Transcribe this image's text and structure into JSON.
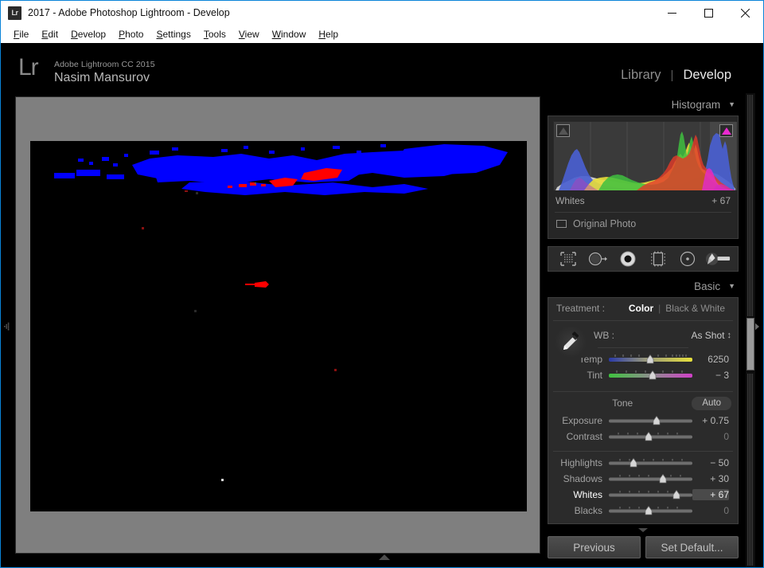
{
  "window": {
    "title": "2017 - Adobe Photoshop Lightroom - Develop",
    "app_icon_label": "Lr",
    "minimize_label": "─",
    "maximize_label": "□",
    "close_label": "✕"
  },
  "menubar": {
    "items": [
      {
        "label": "File",
        "mnemonic": "F"
      },
      {
        "label": "Edit",
        "mnemonic": "E"
      },
      {
        "label": "Develop",
        "mnemonic": "D"
      },
      {
        "label": "Photo",
        "mnemonic": "P"
      },
      {
        "label": "Settings",
        "mnemonic": "S"
      },
      {
        "label": "Tools",
        "mnemonic": "T"
      },
      {
        "label": "View",
        "mnemonic": "V"
      },
      {
        "label": "Window",
        "mnemonic": "W"
      },
      {
        "label": "Help",
        "mnemonic": "H"
      }
    ]
  },
  "identity_plate": {
    "logo": "Lr",
    "line1": "Adobe Lightroom CC 2015",
    "line2": "Nasim Mansurov"
  },
  "module_picker": {
    "modules": [
      {
        "label": "Library",
        "active": false
      },
      {
        "label": "Develop",
        "active": true
      }
    ],
    "separator": "|"
  },
  "panel_toggles": {
    "top": "▲",
    "bottom": "▲",
    "left": "left-panel-toggle",
    "right": "right-panel-toggle"
  },
  "histogram_panel": {
    "title": "Histogram",
    "collapse_glyph": "▼",
    "readout_label": "Whites",
    "readout_value": "+ 67",
    "original_photo_label": "Original Photo",
    "original_photo_checked": false,
    "shadow_clipping_active": false,
    "highlight_clipping_active": true,
    "highlight_clipping_color": "#ea2ad0"
  },
  "tool_strip": {
    "tools": [
      {
        "name": "crop-overlay",
        "title": "Crop Overlay"
      },
      {
        "name": "spot-removal",
        "title": "Spot Removal"
      },
      {
        "name": "red-eye-correction",
        "title": "Red Eye Correction"
      },
      {
        "name": "graduated-filter",
        "title": "Graduated Filter"
      },
      {
        "name": "radial-filter",
        "title": "Radial Filter"
      },
      {
        "name": "adjustment-brush",
        "title": "Adjustment Brush"
      }
    ]
  },
  "basic_panel": {
    "title": "Basic",
    "collapse_glyph": "▼",
    "treatment_label": "Treatment :",
    "treatment_options": [
      {
        "label": "Color",
        "active": true
      },
      {
        "label": "Black & White",
        "active": false
      }
    ],
    "treatment_separator": "|",
    "wb": {
      "label": "WB :",
      "value": "As Shot",
      "stepper_glyph": "↕",
      "sliders": [
        {
          "label": "Temp",
          "value": "6250",
          "pos": 50,
          "gradient": "temp"
        },
        {
          "label": "Tint",
          "value": "− 3",
          "pos": 53,
          "gradient": "tint"
        }
      ]
    },
    "tone": {
      "label": "Tone",
      "auto_label": "Auto",
      "sliders": [
        {
          "label": "Exposure",
          "value": "+ 0.75",
          "pos": 57,
          "active": false,
          "highlighted": false,
          "ticks": false
        },
        {
          "label": "Contrast",
          "value": "0",
          "pos": 48,
          "active": false,
          "highlighted": false,
          "ticks": true,
          "zero": true
        }
      ]
    },
    "presence": {
      "sliders": [
        {
          "label": "Highlights",
          "value": "− 50",
          "pos": 29,
          "active": false,
          "highlighted": false,
          "ticks": true
        },
        {
          "label": "Shadows",
          "value": "+ 30",
          "pos": 65,
          "active": false,
          "highlighted": false,
          "ticks": true
        },
        {
          "label": "Whites",
          "value": "+ 67",
          "pos": 81,
          "active": true,
          "highlighted": true,
          "ticks": true
        },
        {
          "label": "Blacks",
          "value": "0",
          "pos": 48,
          "active": false,
          "highlighted": false,
          "ticks": true,
          "zero": true
        }
      ]
    }
  },
  "bottom_buttons": {
    "previous": "Previous",
    "set_default": "Set Default..."
  },
  "image_view": {
    "background": "#7f7f7f",
    "photo_background": "#000000",
    "clipping_shadow_color": "#0000ff",
    "clipping_highlight_color": "#ff0000"
  }
}
